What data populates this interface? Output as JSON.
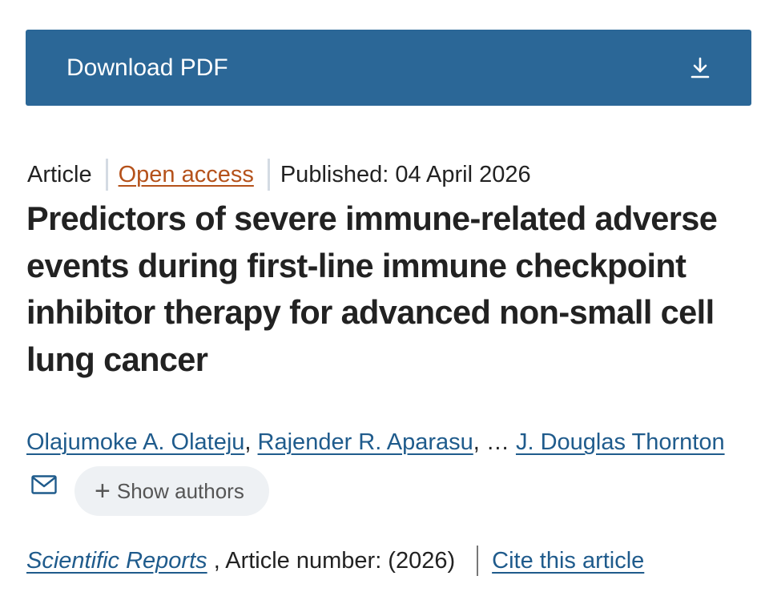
{
  "download": {
    "label": "Download PDF",
    "icon": "download-icon"
  },
  "meta": {
    "type": "Article",
    "access": "Open access",
    "published": "Published: 04 April 2026"
  },
  "article": {
    "title": "Predictors of severe immune-related adverse events during first-line immune checkpoint inhibitor therapy for advanced non-small cell lung cancer"
  },
  "authors": {
    "list": [
      "Olajumoke A. Olateju",
      "Rajender R. Aparasu",
      "J. Douglas Thornton"
    ],
    "separator": ",",
    "ellipsis": "…",
    "email_icon": "mail-icon",
    "show_authors_label": "Show authors",
    "show_authors_icon": "+"
  },
  "citation": {
    "journal": "Scientific Reports",
    "article_number": ", Article number:  (2026)",
    "cite_label": "Cite this article"
  },
  "colors": {
    "download_bg": "#2b6797",
    "link": "#1f5b8c",
    "open_access": "#b5521b",
    "pill_bg": "#eef1f4"
  }
}
